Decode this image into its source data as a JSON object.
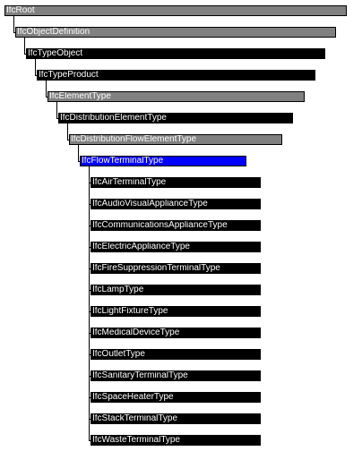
{
  "tree": {
    "nodes": [
      {
        "label": "IfcRoot",
        "kind": "abstract"
      },
      {
        "label": "IfcObjectDefinition",
        "kind": "abstract"
      },
      {
        "label": "IfcTypeObject",
        "kind": "concrete"
      },
      {
        "label": "IfcTypeProduct",
        "kind": "concrete"
      },
      {
        "label": "IfcElementType",
        "kind": "abstract"
      },
      {
        "label": "IfcDistributionElementType",
        "kind": "concrete"
      },
      {
        "label": "IfcDistributionFlowElementType",
        "kind": "abstract"
      },
      {
        "label": "IfcFlowTerminalType",
        "kind": "selected"
      },
      {
        "label": "IfcAirTerminalType",
        "kind": "concrete"
      },
      {
        "label": "IfcAudioVisualApplianceType",
        "kind": "concrete"
      },
      {
        "label": "IfcCommunicationsApplianceType",
        "kind": "concrete"
      },
      {
        "label": "IfcElectricApplianceType",
        "kind": "concrete"
      },
      {
        "label": "IfcFireSuppressionTerminalType",
        "kind": "concrete"
      },
      {
        "label": "IfcLampType",
        "kind": "concrete"
      },
      {
        "label": "IfcLightFixtureType",
        "kind": "concrete"
      },
      {
        "label": "IfcMedicalDeviceType",
        "kind": "concrete"
      },
      {
        "label": "IfcOutletType",
        "kind": "concrete"
      },
      {
        "label": "IfcSanitaryTerminalType",
        "kind": "concrete"
      },
      {
        "label": "IfcSpaceHeaterType",
        "kind": "concrete"
      },
      {
        "label": "IfcStackTerminalType",
        "kind": "concrete"
      },
      {
        "label": "IfcWasteTerminalType",
        "kind": "concrete"
      }
    ]
  },
  "colors": {
    "abstract": "#808080",
    "concrete": "#000000",
    "selected": "#0000ff",
    "text": "#ffffff",
    "line": "#000000"
  }
}
